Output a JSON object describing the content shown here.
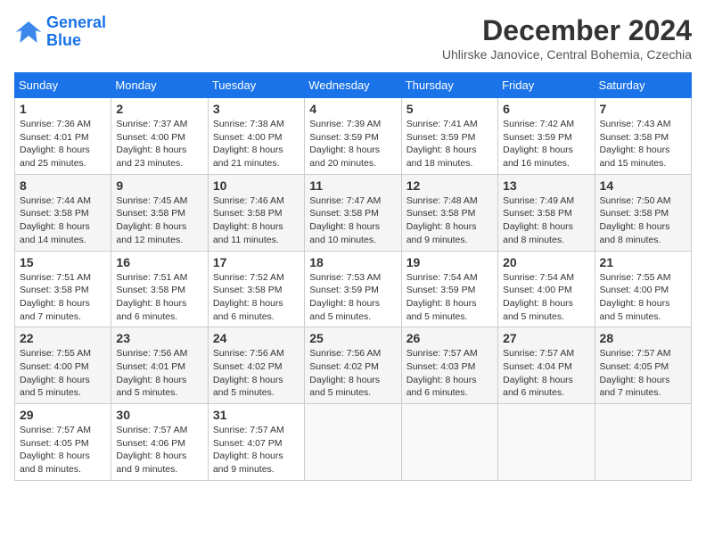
{
  "header": {
    "logo_line1": "General",
    "logo_line2": "Blue",
    "month_title": "December 2024",
    "location": "Uhlirske Janovice, Central Bohemia, Czechia"
  },
  "weekdays": [
    "Sunday",
    "Monday",
    "Tuesday",
    "Wednesday",
    "Thursday",
    "Friday",
    "Saturday"
  ],
  "weeks": [
    [
      {
        "day": "1",
        "info": "Sunrise: 7:36 AM\nSunset: 4:01 PM\nDaylight: 8 hours and 25 minutes."
      },
      {
        "day": "2",
        "info": "Sunrise: 7:37 AM\nSunset: 4:00 PM\nDaylight: 8 hours and 23 minutes."
      },
      {
        "day": "3",
        "info": "Sunrise: 7:38 AM\nSunset: 4:00 PM\nDaylight: 8 hours and 21 minutes."
      },
      {
        "day": "4",
        "info": "Sunrise: 7:39 AM\nSunset: 3:59 PM\nDaylight: 8 hours and 20 minutes."
      },
      {
        "day": "5",
        "info": "Sunrise: 7:41 AM\nSunset: 3:59 PM\nDaylight: 8 hours and 18 minutes."
      },
      {
        "day": "6",
        "info": "Sunrise: 7:42 AM\nSunset: 3:59 PM\nDaylight: 8 hours and 16 minutes."
      },
      {
        "day": "7",
        "info": "Sunrise: 7:43 AM\nSunset: 3:58 PM\nDaylight: 8 hours and 15 minutes."
      }
    ],
    [
      {
        "day": "8",
        "info": "Sunrise: 7:44 AM\nSunset: 3:58 PM\nDaylight: 8 hours and 14 minutes."
      },
      {
        "day": "9",
        "info": "Sunrise: 7:45 AM\nSunset: 3:58 PM\nDaylight: 8 hours and 12 minutes."
      },
      {
        "day": "10",
        "info": "Sunrise: 7:46 AM\nSunset: 3:58 PM\nDaylight: 8 hours and 11 minutes."
      },
      {
        "day": "11",
        "info": "Sunrise: 7:47 AM\nSunset: 3:58 PM\nDaylight: 8 hours and 10 minutes."
      },
      {
        "day": "12",
        "info": "Sunrise: 7:48 AM\nSunset: 3:58 PM\nDaylight: 8 hours and 9 minutes."
      },
      {
        "day": "13",
        "info": "Sunrise: 7:49 AM\nSunset: 3:58 PM\nDaylight: 8 hours and 8 minutes."
      },
      {
        "day": "14",
        "info": "Sunrise: 7:50 AM\nSunset: 3:58 PM\nDaylight: 8 hours and 8 minutes."
      }
    ],
    [
      {
        "day": "15",
        "info": "Sunrise: 7:51 AM\nSunset: 3:58 PM\nDaylight: 8 hours and 7 minutes."
      },
      {
        "day": "16",
        "info": "Sunrise: 7:51 AM\nSunset: 3:58 PM\nDaylight: 8 hours and 6 minutes."
      },
      {
        "day": "17",
        "info": "Sunrise: 7:52 AM\nSunset: 3:58 PM\nDaylight: 8 hours and 6 minutes."
      },
      {
        "day": "18",
        "info": "Sunrise: 7:53 AM\nSunset: 3:59 PM\nDaylight: 8 hours and 5 minutes."
      },
      {
        "day": "19",
        "info": "Sunrise: 7:54 AM\nSunset: 3:59 PM\nDaylight: 8 hours and 5 minutes."
      },
      {
        "day": "20",
        "info": "Sunrise: 7:54 AM\nSunset: 4:00 PM\nDaylight: 8 hours and 5 minutes."
      },
      {
        "day": "21",
        "info": "Sunrise: 7:55 AM\nSunset: 4:00 PM\nDaylight: 8 hours and 5 minutes."
      }
    ],
    [
      {
        "day": "22",
        "info": "Sunrise: 7:55 AM\nSunset: 4:00 PM\nDaylight: 8 hours and 5 minutes."
      },
      {
        "day": "23",
        "info": "Sunrise: 7:56 AM\nSunset: 4:01 PM\nDaylight: 8 hours and 5 minutes."
      },
      {
        "day": "24",
        "info": "Sunrise: 7:56 AM\nSunset: 4:02 PM\nDaylight: 8 hours and 5 minutes."
      },
      {
        "day": "25",
        "info": "Sunrise: 7:56 AM\nSunset: 4:02 PM\nDaylight: 8 hours and 5 minutes."
      },
      {
        "day": "26",
        "info": "Sunrise: 7:57 AM\nSunset: 4:03 PM\nDaylight: 8 hours and 6 minutes."
      },
      {
        "day": "27",
        "info": "Sunrise: 7:57 AM\nSunset: 4:04 PM\nDaylight: 8 hours and 6 minutes."
      },
      {
        "day": "28",
        "info": "Sunrise: 7:57 AM\nSunset: 4:05 PM\nDaylight: 8 hours and 7 minutes."
      }
    ],
    [
      {
        "day": "29",
        "info": "Sunrise: 7:57 AM\nSunset: 4:05 PM\nDaylight: 8 hours and 8 minutes."
      },
      {
        "day": "30",
        "info": "Sunrise: 7:57 AM\nSunset: 4:06 PM\nDaylight: 8 hours and 9 minutes."
      },
      {
        "day": "31",
        "info": "Sunrise: 7:57 AM\nSunset: 4:07 PM\nDaylight: 8 hours and 9 minutes."
      },
      null,
      null,
      null,
      null
    ]
  ]
}
